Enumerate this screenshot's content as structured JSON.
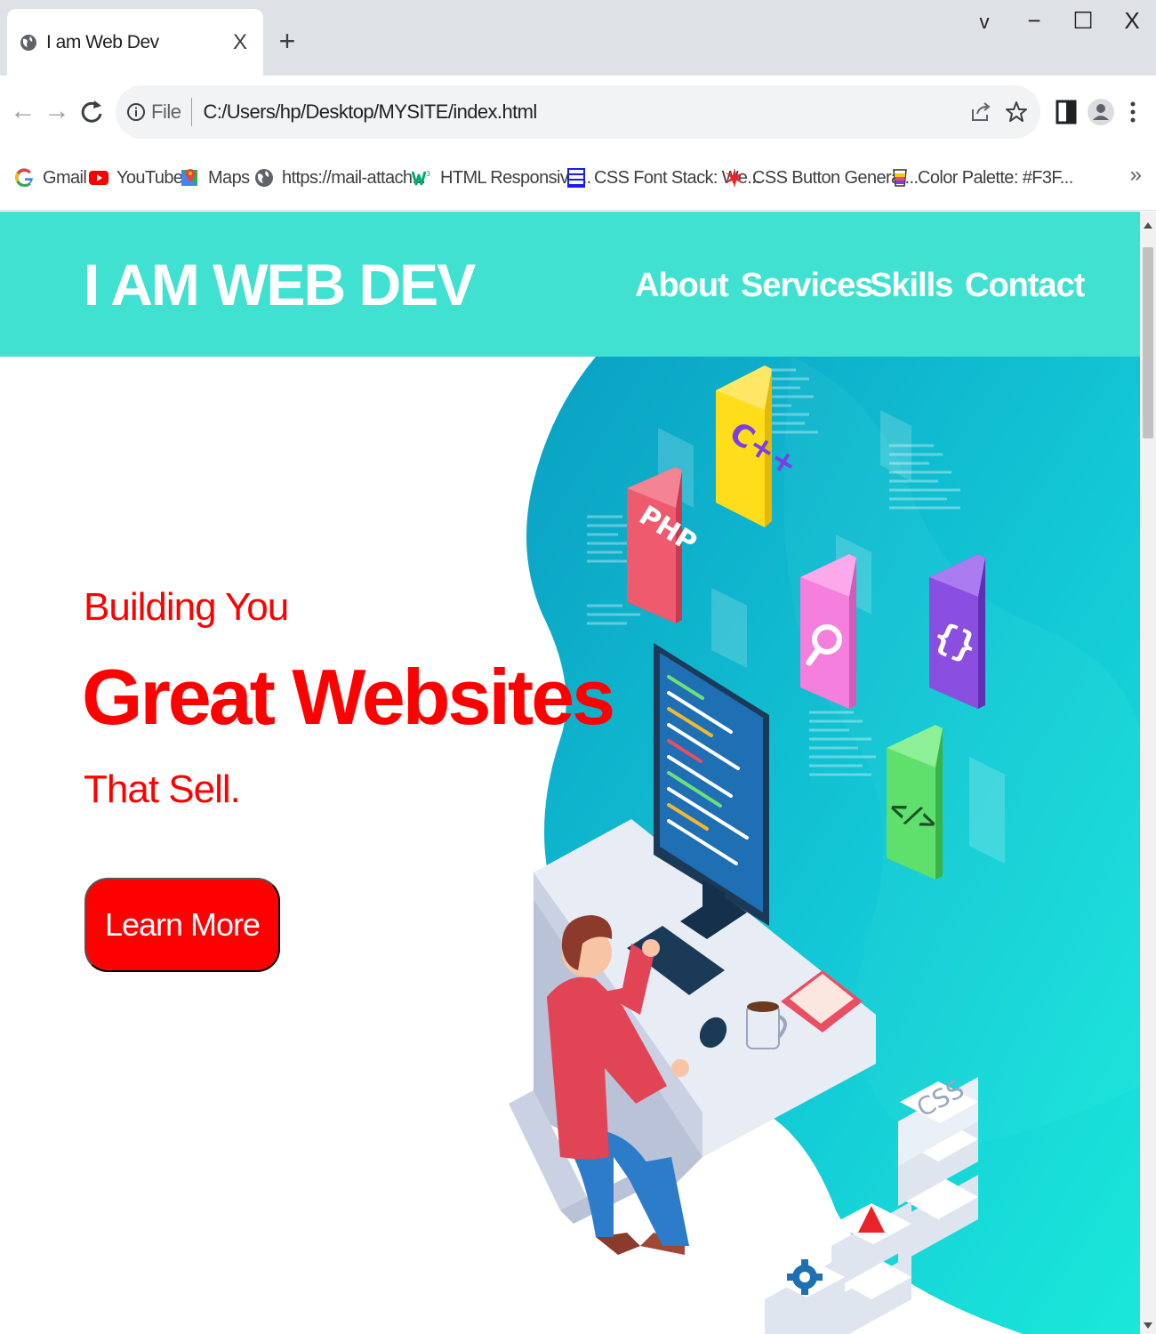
{
  "browser": {
    "tab": {
      "title": "I am Web Dev",
      "close": "X"
    },
    "new_tab": "+",
    "window_controls": {
      "chevron": "v",
      "minimize": "−",
      "maximize": "☐",
      "close": "X"
    },
    "nav": {
      "back": "←",
      "forward": "→",
      "reload": "C"
    },
    "address": {
      "scheme_label": "File",
      "url": "C:/Users/hp/Desktop/MYSITE/index.html"
    },
    "bookmarks": [
      {
        "label": "Gmail",
        "icon": "google-icon"
      },
      {
        "label": "YouTube",
        "icon": "youtube-icon"
      },
      {
        "label": "Maps",
        "icon": "maps-icon"
      },
      {
        "label": "https://mail-attach...",
        "icon": "globe-icon"
      },
      {
        "label": "HTML Responsive...",
        "icon": "w3-icon"
      },
      {
        "label": "CSS Font Stack: We...",
        "icon": "cssfont-icon"
      },
      {
        "label": "CSS Button Generat...",
        "icon": "star-burst-icon"
      },
      {
        "label": "Color Palette: #F3F...",
        "icon": "cup-icon"
      }
    ],
    "bookmarks_more": "»"
  },
  "site": {
    "logo": "I AM WEB DEV",
    "nav": [
      "About",
      "Services",
      "Skills",
      "Contact"
    ],
    "hero": {
      "eyebrow": "Building You",
      "headline": "Great Websites",
      "tagline": "That Sell.",
      "cta": "Learn More"
    },
    "illustration": {
      "tiles": [
        "PHP",
        "C++",
        "{}",
        "</>",
        "CSS"
      ]
    }
  },
  "colors": {
    "header_bg": "#41e1d1",
    "accent_red": "#ff0000",
    "teal_dark": "#0aa5c3",
    "teal_light": "#19e6d7"
  }
}
